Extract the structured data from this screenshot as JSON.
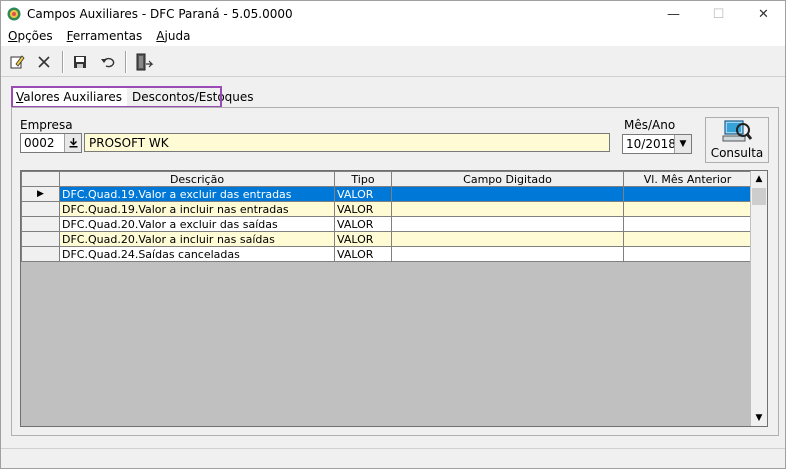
{
  "window": {
    "title": "Campos Auxiliares - DFC Paraná - 5.05.0000",
    "minimize": "—",
    "maximize": "☐",
    "close": "✕"
  },
  "menu": [
    {
      "u": "O",
      "rest": "pções"
    },
    {
      "u": "F",
      "rest": "erramentas"
    },
    {
      "u": "A",
      "rest": "juda"
    }
  ],
  "toolbar": {
    "icons": [
      "edit-icon",
      "delete-icon",
      "save-icon",
      "undo-icon",
      "exit-icon"
    ]
  },
  "tabs": [
    {
      "u": "V",
      "rest": "alores Auxiliares"
    },
    {
      "u": "",
      "rest": "Descontos/Estoques"
    }
  ],
  "form": {
    "empresa_label": "Empresa",
    "empresa_code": "0002",
    "empresa_name": "PROSOFT WK",
    "mesano_label": "Mês/Ano",
    "mesano_value": "10/2018",
    "consulta_label": "Consulta"
  },
  "grid": {
    "columns": [
      "Descrição",
      "Tipo",
      "Campo Digitado",
      "Vl. Mês Anterior"
    ],
    "rows": [
      {
        "descricao": "DFC.Quad.19.Valor a excluir das entradas",
        "tipo": "VALOR",
        "campo": "",
        "anterior": ""
      },
      {
        "descricao": "DFC.Quad.19.Valor a incluir nas entradas",
        "tipo": "VALOR",
        "campo": "",
        "anterior": ""
      },
      {
        "descricao": "DFC.Quad.20.Valor a excluir das saídas",
        "tipo": "VALOR",
        "campo": "",
        "anterior": ""
      },
      {
        "descricao": "DFC.Quad.20.Valor a incluir nas saídas",
        "tipo": "VALOR",
        "campo": "",
        "anterior": ""
      },
      {
        "descricao": "DFC.Quad.24.Saídas canceladas",
        "tipo": "VALOR",
        "campo": "",
        "anterior": ""
      }
    ],
    "selected_row": 0
  },
  "colors": {
    "selection": "#0078d7",
    "highlight_border": "#9b4bb5",
    "yellow_field": "#fffbd5"
  }
}
